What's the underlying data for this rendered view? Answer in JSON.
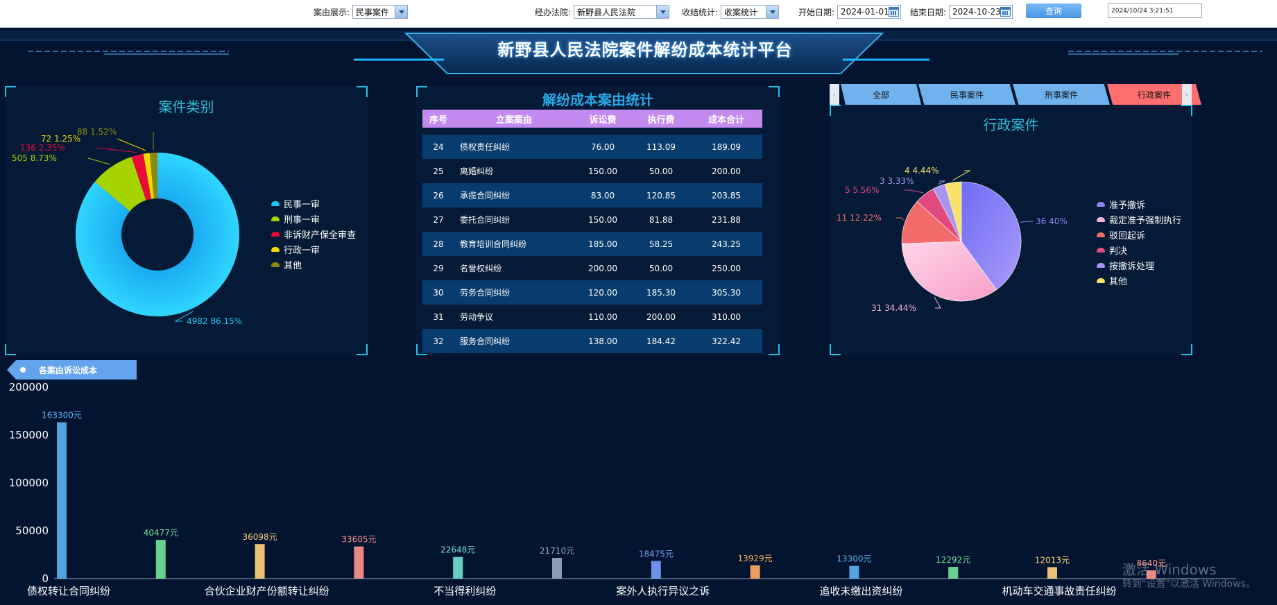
{
  "toolbar": {
    "case_display_label": "案由展示:",
    "case_display_value": "民事案件",
    "court_label": "经办法院:",
    "court_value": "新野县人民法院",
    "stat_label": "收结统计:",
    "stat_value": "收案统计",
    "start_label": "开始日期:",
    "start_value": "2024-01-01",
    "end_label": "结束日期:",
    "end_value": "2024-10-23",
    "query_button": "查询",
    "clock": "2024/10/24 3:21:51"
  },
  "header": {
    "title": "新野县人民法院案件解纷成本统计平台"
  },
  "case_type_panel": {
    "title": "案件类别",
    "legend": [
      {
        "label": "民事一审",
        "color": "#1ec8f4"
      },
      {
        "label": "刑事一审",
        "color": "#a6d400"
      },
      {
        "label": "非诉财产保全审查",
        "color": "#ea0a3a"
      },
      {
        "label": "行政一审",
        "color": "#f5d800"
      },
      {
        "label": "其他",
        "color": "#8a8a10"
      }
    ]
  },
  "cost_table": {
    "title": "解纷成本案由统计",
    "headers": [
      "序号",
      "立案案由",
      "诉讼费",
      "执行费",
      "成本合计"
    ],
    "rows": [
      [
        "24",
        "债权责任纠纷",
        "76.00",
        "113.09",
        "189.09"
      ],
      [
        "25",
        "离婚纠纷",
        "150.00",
        "50.00",
        "200.00"
      ],
      [
        "26",
        "承揽合同纠纷",
        "83.00",
        "120.85",
        "203.85"
      ],
      [
        "27",
        "委托合同纠纷",
        "150.00",
        "81.88",
        "231.88"
      ],
      [
        "28",
        "教育培训合同纠纷",
        "185.00",
        "58.25",
        "243.25"
      ],
      [
        "29",
        "名誉权纠纷",
        "200.00",
        "50.00",
        "250.00"
      ],
      [
        "30",
        "劳务合同纠纷",
        "120.00",
        "185.30",
        "305.30"
      ],
      [
        "31",
        "劳动争议",
        "110.00",
        "200.00",
        "310.00"
      ],
      [
        "32",
        "服务合同纠纷",
        "138.00",
        "184.42",
        "322.42"
      ]
    ]
  },
  "tabs": {
    "items": [
      "全部",
      "民事案件",
      "刑事案件",
      "行政案件"
    ],
    "active_index": 3,
    "left_arrow": "‹",
    "right_arrow": "›"
  },
  "admin_panel": {
    "title": "行政案件",
    "legend": [
      {
        "label": "准予撤诉",
        "color": "#8d86f7"
      },
      {
        "label": "裁定准予强制执行",
        "color": "#f7b8d6"
      },
      {
        "label": "驳回起诉",
        "color": "#f26c6c"
      },
      {
        "label": "判决",
        "color": "#df4a80"
      },
      {
        "label": "按撤诉处理",
        "color": "#a796f0"
      },
      {
        "label": "其他",
        "color": "#f8e26a"
      }
    ]
  },
  "bottom_panel": {
    "tag_label": "各案由诉讼成本"
  },
  "watermark": {
    "line1": "激活 Windows",
    "line2": "转到\"设置\"以激活 Windows。"
  },
  "chart_data": [
    {
      "type": "pie",
      "title": "案件类别",
      "donut": true,
      "labels": [
        "民事一审",
        "刑事一审",
        "非诉财产保全审查",
        "行政一审",
        "其他"
      ],
      "values": [
        4982,
        505,
        136,
        72,
        88
      ],
      "percents": [
        "86.15%",
        "8.73%",
        "2.35%",
        "1.25%",
        "1.52%"
      ],
      "colors": [
        "#1ec8f4",
        "#a6d400",
        "#ea0a3a",
        "#f5d800",
        "#8a8a10"
      ]
    },
    {
      "type": "pie",
      "title": "行政案件",
      "donut": false,
      "labels": [
        "准予撤诉",
        "裁定准予强制执行",
        "驳回起诉",
        "判决",
        "按撤诉处理",
        "其他"
      ],
      "values": [
        36,
        31,
        11,
        5,
        3,
        4
      ],
      "percents": [
        "40%",
        "34.44%",
        "12.22%",
        "5.56%",
        "3.33%",
        "4.44%"
      ],
      "colors": [
        "#8d86f7",
        "#f7b8d6",
        "#f26c6c",
        "#df4a80",
        "#a796f0",
        "#f8e26a"
      ]
    },
    {
      "type": "bar",
      "title": "各案由诉讼成本",
      "ylim": [
        0,
        200000
      ],
      "yticks": [
        "0",
        "50000",
        "100000",
        "150000",
        "200000"
      ],
      "category_labels": [
        "债权转让合同纠纷",
        "合伙企业财产份额转让纠纷",
        "不当得利纠纷",
        "案外人执行异议之诉",
        "追收未缴出资纠纷",
        "机动车交通事故责任纠纷"
      ],
      "values": [
        163300,
        40477,
        36098,
        33605,
        22648,
        21710,
        18475,
        13929,
        13300,
        12292,
        12013,
        8640
      ],
      "value_labels": [
        "163300元",
        "40477元",
        "36098元",
        "33605元",
        "22648元",
        "21710元",
        "18475元",
        "13929元",
        "13300元",
        "12292元",
        "12013元",
        "8640元"
      ],
      "colors": [
        "#5ab1f0",
        "#6fe29a",
        "#ffd07a",
        "#ff938a",
        "#6ee0d0",
        "#9aa5c0",
        "#7a9cf5",
        "#ffaa60",
        "#5ab1f0",
        "#6fe29a",
        "#ffd07a",
        "#ff938a"
      ]
    }
  ]
}
